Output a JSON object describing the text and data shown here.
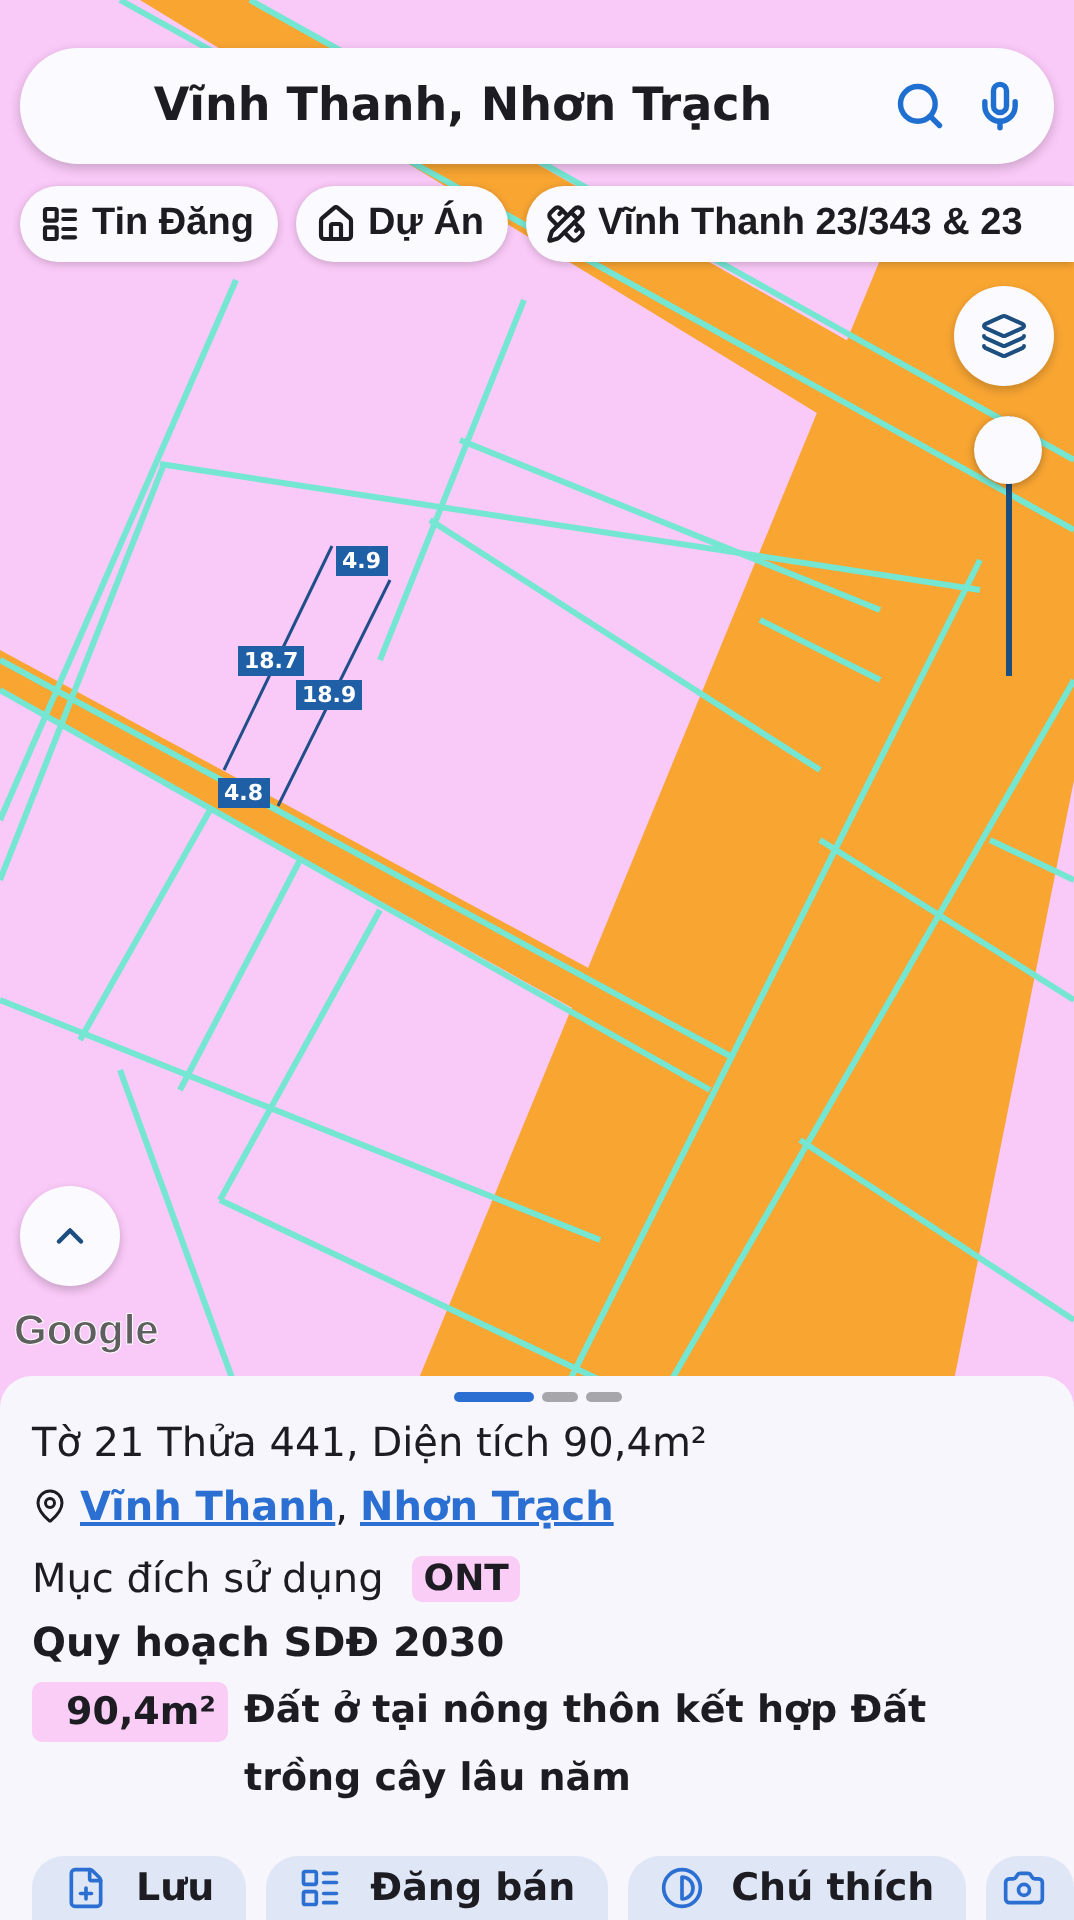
{
  "search": {
    "value": "Vĩnh Thanh, Nhơn Trạch"
  },
  "chips": [
    {
      "kind": "listings",
      "label": "Tin Đăng"
    },
    {
      "kind": "projects",
      "label": "Dự Án"
    },
    {
      "kind": "measure",
      "label": "Vĩnh Thanh 23/343 & 23"
    }
  ],
  "map": {
    "zoom_slider": {
      "level": 1
    },
    "measurements": [
      {
        "label": "4.9"
      },
      {
        "label": "18.7"
      },
      {
        "label": "18.9"
      },
      {
        "label": "4.8"
      }
    ],
    "attribution": "Google"
  },
  "sheet": {
    "pages": [
      {
        "selected": true
      },
      {
        "selected": false
      },
      {
        "selected": false
      }
    ],
    "title": "Tờ 21 Thửa 441, Diện tích 90,4m²",
    "location": [
      "Vĩnh Thanh",
      "Nhơn Trạch"
    ],
    "location_separator": ",",
    "purpose_label": "Mục đích sử dụng",
    "purpose_code": "ONT",
    "plan_heading": "Quy hoạch SDĐ 2030",
    "plan_area": "90,4m²",
    "plan_description": "Đất ở tại nông thôn kết hợp Đất trồng cây lâu năm",
    "actions": [
      {
        "kind": "save",
        "label": "Lưu"
      },
      {
        "kind": "post",
        "label": "Đăng bán"
      },
      {
        "kind": "legend",
        "label": "Chú thích"
      },
      {
        "kind": "camera"
      }
    ]
  }
}
